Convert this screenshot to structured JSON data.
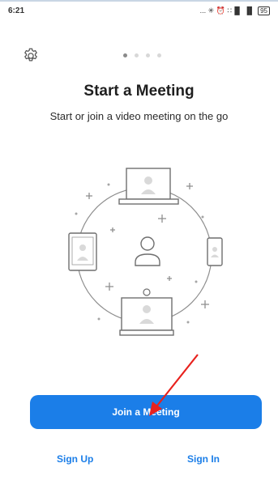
{
  "status_bar": {
    "time": "6:21",
    "icons_text": "... ✳ ⏰ ∷▐▌ ▐▌",
    "battery": "95"
  },
  "onboarding": {
    "title": "Start a Meeting",
    "subtitle": "Start or join a video meeting on the go",
    "page_dots": 4,
    "active_dot": 0
  },
  "actions": {
    "join_label": "Join a Meeting",
    "signup_label": "Sign Up",
    "signin_label": "Sign In"
  },
  "icons": {
    "settings": "gear-icon",
    "illustration": "devices-circle-illustration",
    "annotation": "red-arrow-annotation"
  },
  "colors": {
    "accent": "#1b7ee8",
    "annotation_red": "#e8211d"
  }
}
